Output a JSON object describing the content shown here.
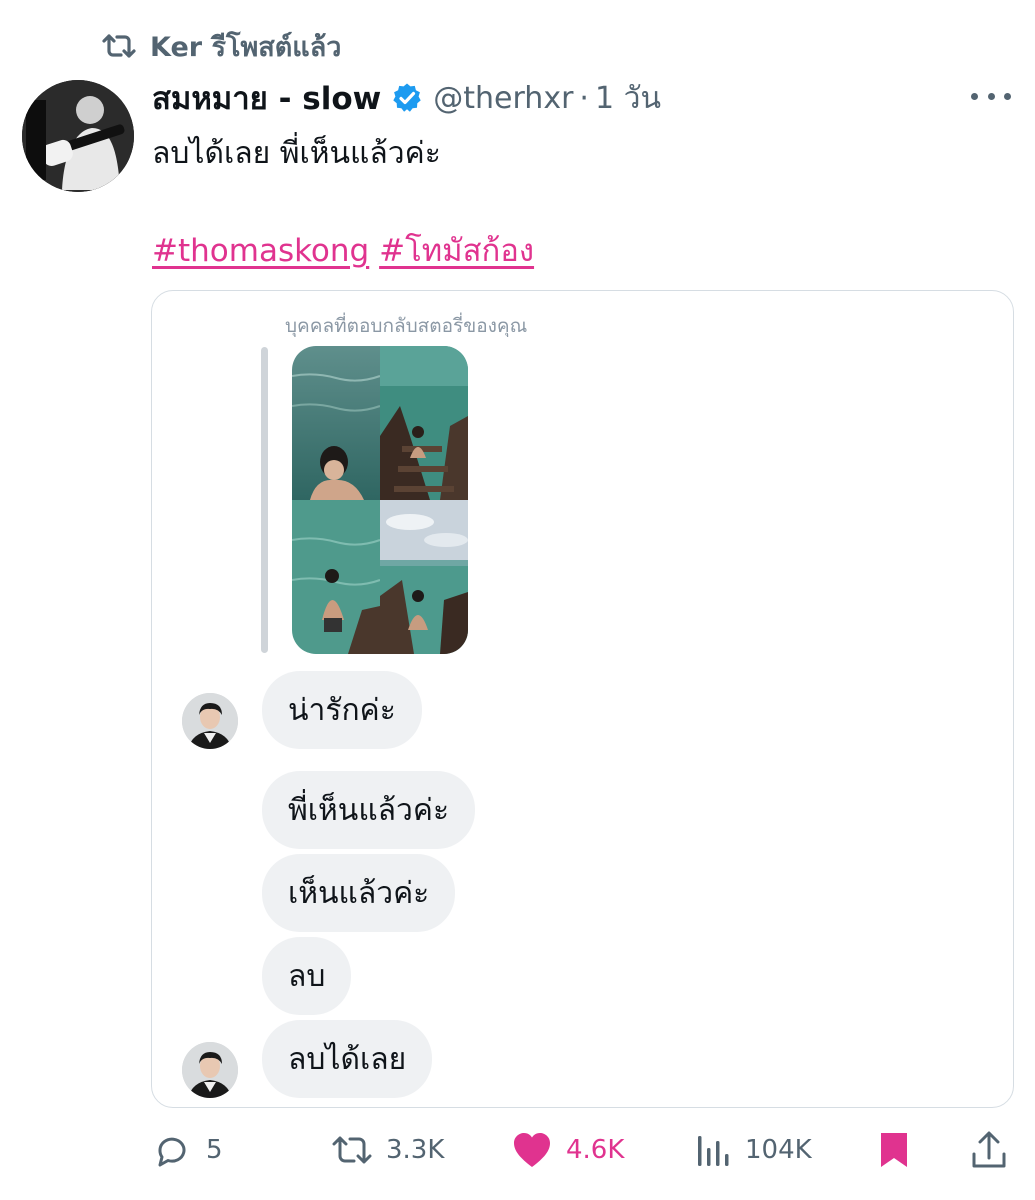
{
  "repost": {
    "label": "Ker รีโพสต์แล้ว",
    "icon": "repost-icon"
  },
  "post": {
    "author_name": "สมหมาย - slow",
    "verified": true,
    "handle": "@therhxr",
    "separator": "·",
    "time": "1 วัน",
    "text": "ลบได้เลย พี่เห็นแล้วค่ะ",
    "hashtags": [
      "#thomaskong",
      "#โทมัสก้อง"
    ]
  },
  "card": {
    "story_label": "บุคคลที่ตอบกลับสตอรี่ของคุณ",
    "messages": [
      {
        "text": "น่ารักค่ะ",
        "show_avatar": true
      },
      {
        "text": "พี่เห็นแล้วค่ะ",
        "show_avatar": false
      },
      {
        "text": "เห็นแล้วค่ะ",
        "show_avatar": false
      },
      {
        "text": "ลบ",
        "show_avatar": false
      },
      {
        "text": "ลบได้เลย",
        "show_avatar": true
      }
    ]
  },
  "actions": {
    "replies": "5",
    "reposts": "3.3K",
    "likes": "4.6K",
    "views": "104K",
    "bookmarked": true
  },
  "colors": {
    "accent_pink": "#e0338f",
    "verified_blue": "#1d9bf0",
    "muted_text": "#536471",
    "bubble_bg": "#eff1f3"
  }
}
